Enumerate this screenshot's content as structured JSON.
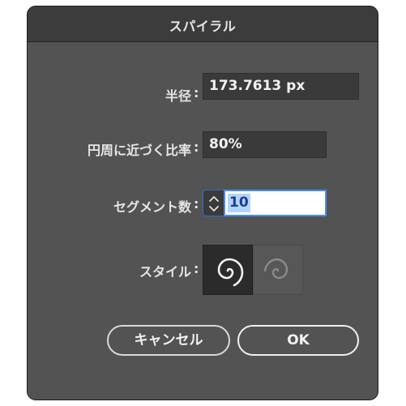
{
  "dialog": {
    "title": "スパイラル"
  },
  "fields": {
    "radius": {
      "label": "半径",
      "value": "173.7613 px"
    },
    "decay": {
      "label": "円周に近づく比率",
      "value": "80%"
    },
    "segments": {
      "label": "セグメント数",
      "value": "10"
    }
  },
  "style": {
    "label": "スタイル",
    "options": [
      {
        "icon": "spiral-clockwise-icon",
        "selected": true
      },
      {
        "icon": "spiral-counterclockwise-icon",
        "selected": false
      }
    ]
  },
  "colon": ":",
  "buttons": {
    "cancel_label": "キャンセル",
    "ok_label": "OK"
  },
  "colors": {
    "dialog_bg": "#535353",
    "titlebar_bg": "#3c3c3c",
    "field_bg": "#3a3a3a",
    "focus": "#4a8ff0",
    "selection": "#b3d3fd"
  }
}
